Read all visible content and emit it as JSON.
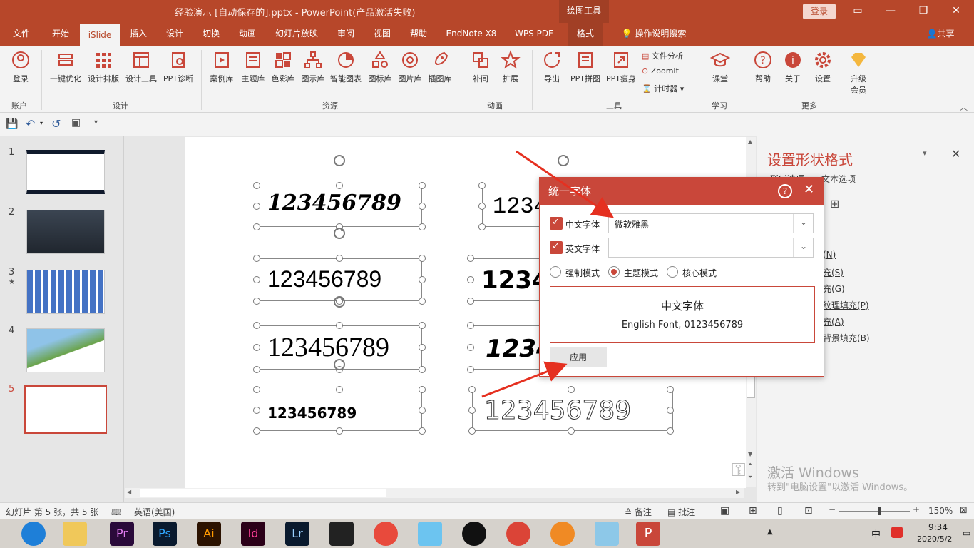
{
  "titlebar": {
    "title": "经验演示 [自动保存的].pptx  -  PowerPoint(产品激活失败)",
    "context_tool": "绘图工具",
    "login": "登录"
  },
  "tabs": [
    "文件",
    "开始",
    "iSlide",
    "插入",
    "设计",
    "切换",
    "动画",
    "幻灯片放映",
    "审阅",
    "视图",
    "帮助",
    "EndNote X8",
    "WPS PDF",
    "格式"
  ],
  "tell_me": "操作说明搜索",
  "share": "共享",
  "ribbon": {
    "buttons": [
      "登录",
      "一键优化",
      "设计排版",
      "设计工具",
      "PPT诊断",
      "案例库",
      "主题库",
      "色彩库",
      "图示库",
      "智能图表",
      "图标库",
      "图片库",
      "插图库",
      "补间",
      "扩展",
      "导出",
      "PPT拼图",
      "PPT瘦身",
      "课堂",
      "帮助",
      "关于",
      "设置",
      "升级会员"
    ],
    "small": [
      "文件分析",
      "ZoomIt",
      "计时器"
    ],
    "groups": [
      "账户",
      "设计",
      "资源",
      "动画",
      "工具",
      "学习",
      "更多"
    ]
  },
  "thumbs": [
    "1",
    "2",
    "3",
    "4",
    "5"
  ],
  "canvas": {
    "numbers": "123456789"
  },
  "rightpane": {
    "title": "设置形状格式",
    "tab1": "形状选项",
    "tab2": "文本选项",
    "items": [
      "(N)",
      "充(S)",
      "充(G)",
      "纹理填充(P)",
      "充(A)",
      "背景填充(B)"
    ]
  },
  "dialog": {
    "title": "统一字体",
    "cn_label": "中文字体",
    "cn_value": "微软雅黑",
    "en_label": "英文字体",
    "en_value": "",
    "modes": [
      "强制模式",
      "主题模式",
      "核心模式"
    ],
    "preview_cn": "中文字体",
    "preview_en": "English Font, 0123456789",
    "apply": "应用"
  },
  "watermark": {
    "line1": "激活 Windows",
    "line2": "转到\"电脑设置\"以激活 Windows。"
  },
  "status": {
    "slide": "幻灯片 第 5 张，共 5 张",
    "lang": "英语(美国)",
    "notes": "备注",
    "comments": "批注",
    "zoom": "150%"
  },
  "taskbar": {
    "time": "9:34",
    "date": "2020/5/2",
    "ime": "中"
  },
  "colors": {
    "accent": "#b7472a",
    "dialog": "#c9473a"
  }
}
